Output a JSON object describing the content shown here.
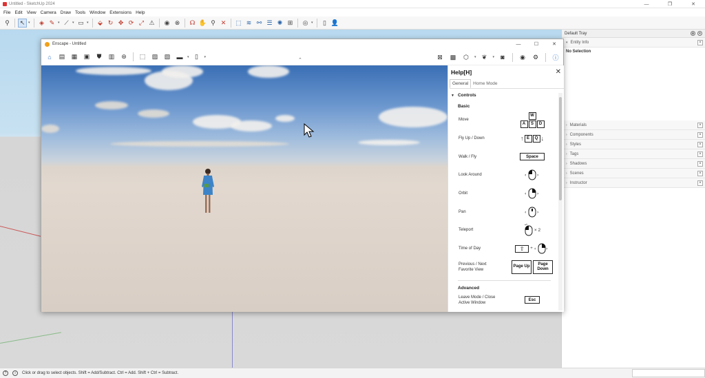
{
  "sketchup": {
    "title": "Untitled - SketchUp 2024",
    "menu": [
      "File",
      "Edit",
      "View",
      "Camera",
      "Draw",
      "Tools",
      "Window",
      "Extensions",
      "Help"
    ],
    "status_text": "Click or drag to select objects. Shift = Add/Subtract. Ctrl = Add. Shift + Ctrl = Subtract."
  },
  "tray": {
    "title": "Default Tray",
    "entity_info": {
      "label": "Entity Info",
      "body": "No Selection"
    },
    "panels": [
      "Materials",
      "Components",
      "Styles",
      "Tags",
      "Shadows",
      "Scenes",
      "Instructor"
    ]
  },
  "enscape": {
    "title": "Enscape - Untitled",
    "help": {
      "title": "Help[H]",
      "tabs": [
        "General",
        "Home Mode"
      ],
      "controls_heading": "Controls",
      "basic_heading": "Basic",
      "advanced_heading": "Advanced",
      "rows": [
        {
          "label": "Move",
          "keys": [
            "W",
            "A",
            "S",
            "D"
          ]
        },
        {
          "label": "Fly Up / Down",
          "keys": [
            "E",
            "Q"
          ]
        },
        {
          "label": "Walk / Fly",
          "keys": [
            "Space"
          ]
        },
        {
          "label": "Look Around"
        },
        {
          "label": "Orbit"
        },
        {
          "label": "Pan"
        },
        {
          "label": "Teleport",
          "suffix": "× 2"
        },
        {
          "label": "Time of Day",
          "suffix": "+"
        },
        {
          "label_line1": "Previous / Next",
          "label_line2": "Favorite View",
          "keys": [
            "Page Up",
            "Page Down"
          ]
        }
      ],
      "advanced_row": {
        "label_line1": "Leave Mode / Close",
        "label_line2": "Active Window",
        "key": "Esc"
      }
    }
  },
  "icons": {
    "sketchup_toolbar": [
      "zoom-icon",
      "select-icon",
      "eraser-icon",
      "pencil-icon",
      "line-icon",
      "shape-icon",
      "push-pull-icon",
      "move-icon",
      "rotate-icon",
      "scale-icon",
      "tape-measure-icon",
      "orbit-icon",
      "pan-icon",
      "zoom-extents-icon",
      "enscape-icon",
      "account-icon"
    ],
    "enscape_toolbar": [
      "home-icon",
      "settings-icon",
      "viewport-icon",
      "camera-icon",
      "bim-icon",
      "asset-library-icon",
      "screenshot-icon",
      "video-icon",
      "export-icon",
      "vr-icon",
      "visibility-icon",
      "gear-icon",
      "help-icon"
    ]
  },
  "colors": {
    "enscape_accent": "#2c72c6",
    "sketchup_red_tools": "#c0392b"
  }
}
